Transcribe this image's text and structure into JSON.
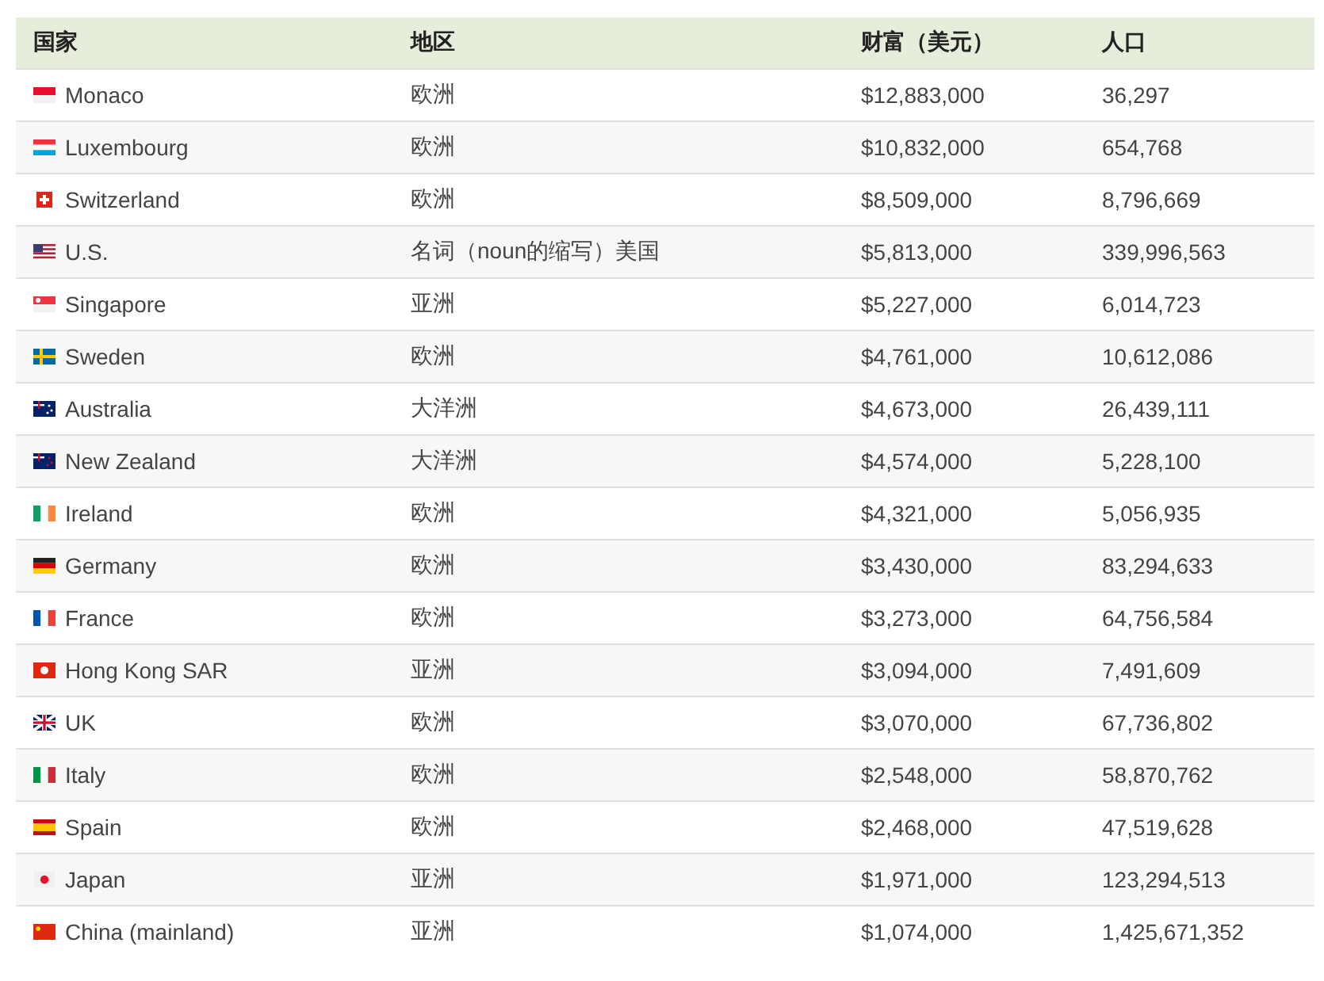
{
  "table": {
    "columns": [
      "国家",
      "地区",
      "财富（美元）",
      "人口"
    ],
    "rows": [
      {
        "kind": "mc",
        "country": "Monaco",
        "region": "欧洲",
        "wealth": "$12,883,000",
        "population": "36,297"
      },
      {
        "kind": "lu",
        "country": "Luxembourg",
        "region": "欧洲",
        "wealth": "$10,832,000",
        "population": "654,768"
      },
      {
        "kind": "ch",
        "country": "Switzerland",
        "region": "欧洲",
        "wealth": "$8,509,000",
        "population": "8,796,669"
      },
      {
        "kind": "us",
        "country": "U.S.",
        "region": "名词（noun的缩写）美国",
        "wealth": "$5,813,000",
        "population": "339,996,563"
      },
      {
        "kind": "sg",
        "country": "Singapore",
        "region": "亚洲",
        "wealth": "$5,227,000",
        "population": "6,014,723"
      },
      {
        "kind": "se",
        "country": "Sweden",
        "region": "欧洲",
        "wealth": "$4,761,000",
        "population": "10,612,086"
      },
      {
        "kind": "au",
        "country": "Australia",
        "region": "大洋洲",
        "wealth": "$4,673,000",
        "population": "26,439,111"
      },
      {
        "kind": "nz",
        "country": "New Zealand",
        "region": "大洋洲",
        "wealth": "$4,574,000",
        "population": "5,228,100"
      },
      {
        "kind": "ie",
        "country": "Ireland",
        "region": "欧洲",
        "wealth": "$4,321,000",
        "population": "5,056,935"
      },
      {
        "kind": "de",
        "country": "Germany",
        "region": "欧洲",
        "wealth": "$3,430,000",
        "population": "83,294,633"
      },
      {
        "kind": "fr",
        "country": "France",
        "region": "欧洲",
        "wealth": "$3,273,000",
        "population": "64,756,584"
      },
      {
        "kind": "hk",
        "country": "Hong Kong SAR",
        "region": "亚洲",
        "wealth": "$3,094,000",
        "population": "7,491,609"
      },
      {
        "kind": "gb",
        "country": "UK",
        "region": "欧洲",
        "wealth": "$3,070,000",
        "population": "67,736,802"
      },
      {
        "kind": "it",
        "country": "Italy",
        "region": "欧洲",
        "wealth": "$2,548,000",
        "population": "58,870,762"
      },
      {
        "kind": "es",
        "country": "Spain",
        "region": "欧洲",
        "wealth": "$2,468,000",
        "population": "47,519,628"
      },
      {
        "kind": "jp",
        "country": "Japan",
        "region": "亚洲",
        "wealth": "$1,971,000",
        "population": "123,294,513"
      },
      {
        "kind": "cn",
        "country": "China (mainland)",
        "region": "亚洲",
        "wealth": "$1,074,000",
        "population": "1,425,671,352"
      }
    ]
  }
}
